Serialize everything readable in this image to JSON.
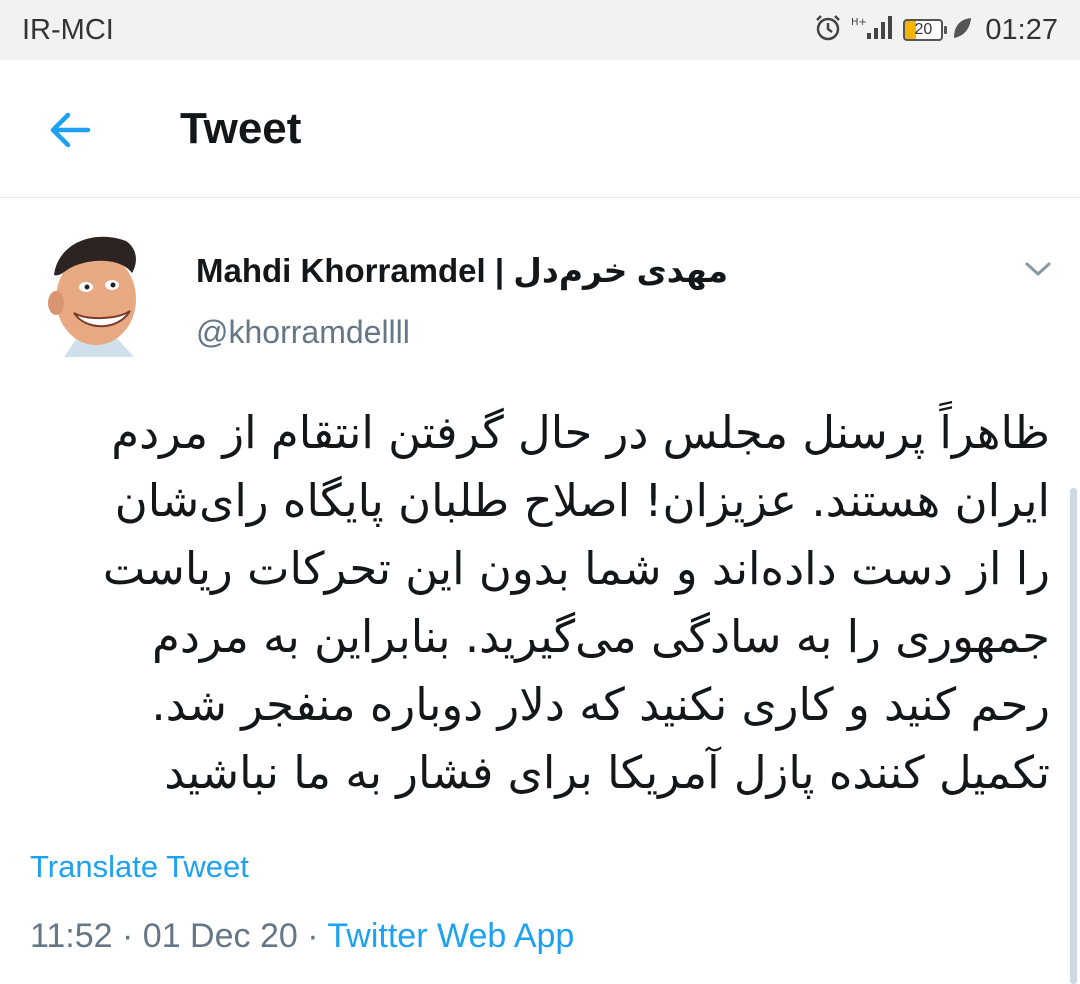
{
  "status_bar": {
    "carrier": "IR-MCI",
    "battery_level": "20",
    "time": "01:27"
  },
  "header": {
    "title": "Tweet"
  },
  "tweet": {
    "author_name": "Mahdi Khorramdel | مهدی خرم‌دل",
    "author_handle": "@khorramdellll",
    "text_lines": [
      "ظاهراً پرسنل مجلس در حال گرفتن انتقام از مردم",
      "ایران هستند. عزیزان! اصلاح طلبان پایگاه رای‌شان",
      "را از دست داده‌اند و شما بدون این تحرکات ریاست",
      "جمهوری را به سادگی می‌گیرید. بنابراین به مردم",
      "رحم کنید و کاری نکنید که دلار دوباره منفجر شد.",
      "تکمیل کننده پازل آمریکا برای فشار به ما نباشید"
    ],
    "translate_label": "Translate Tweet",
    "time": "11:52",
    "separator": " · ",
    "date": "01 Dec 20",
    "source": "Twitter Web App"
  },
  "colors": {
    "accent": "#1da1f2",
    "secondary_text": "#657786",
    "primary_text": "#14171a"
  },
  "icons": [
    "alarm-icon",
    "signal-icon",
    "battery-icon",
    "leaf-icon",
    "back-arrow-icon",
    "chevron-down-icon"
  ]
}
